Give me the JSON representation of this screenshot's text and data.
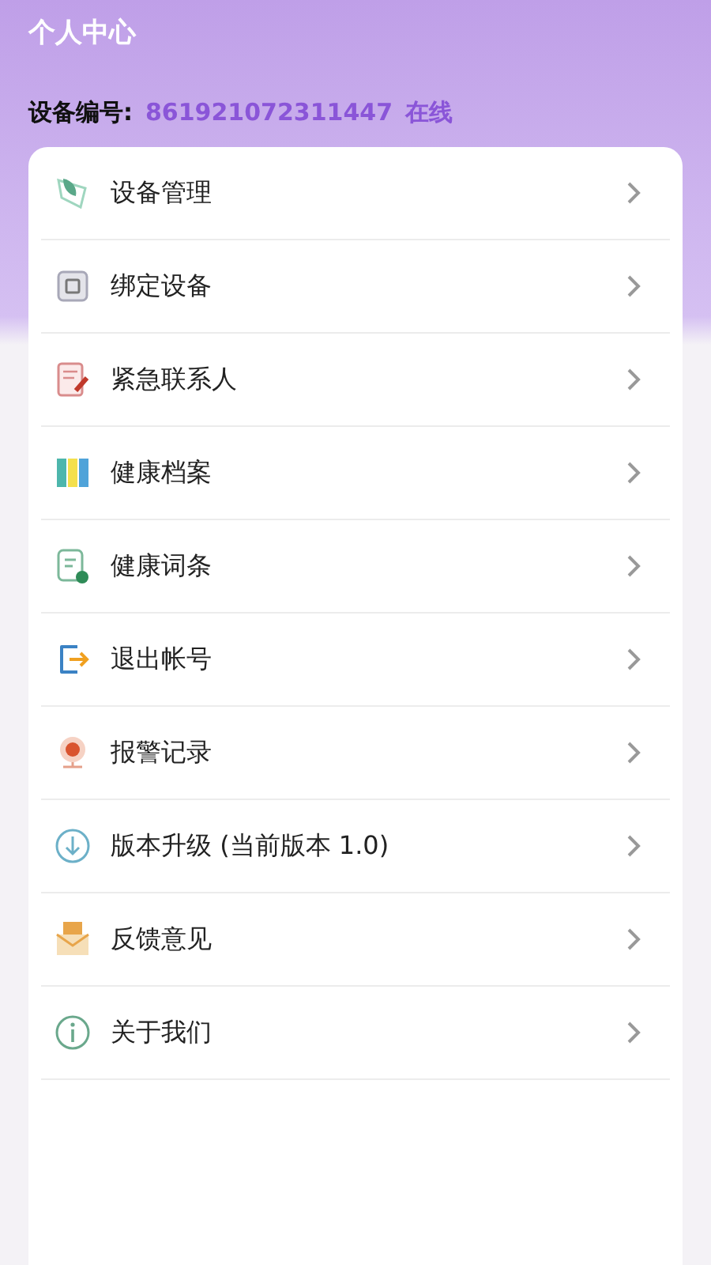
{
  "header": {
    "title": "个人中心",
    "device_label": "设备编号:",
    "device_id": "861921072311447",
    "status": "在线"
  },
  "menu": [
    {
      "kind": "leaf",
      "label": "设备管理"
    },
    {
      "kind": "device",
      "label": "绑定设备"
    },
    {
      "kind": "contact",
      "label": "紧急联系人"
    },
    {
      "kind": "folders",
      "label": "健康档案"
    },
    {
      "kind": "note",
      "label": "健康词条"
    },
    {
      "kind": "logout",
      "label": "退出帐号"
    },
    {
      "kind": "alarm",
      "label": "报警记录"
    },
    {
      "kind": "download",
      "label": "版本升级 (当前版本 1.0)"
    },
    {
      "kind": "mail",
      "label": "反馈意见"
    },
    {
      "kind": "info",
      "label": "关于我们"
    }
  ]
}
